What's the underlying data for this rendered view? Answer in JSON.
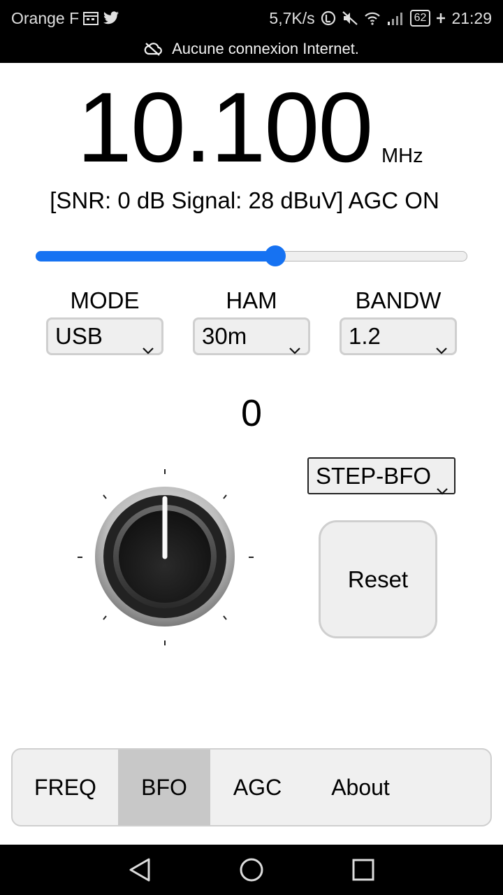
{
  "status_bar": {
    "carrier": "Orange F",
    "net_speed": "5,7K/s",
    "battery": "62",
    "time": "21:29",
    "notice": "Aucune connexion Internet."
  },
  "radio": {
    "frequency": "10.100",
    "unit": "MHz",
    "signal_line": "[SNR:  0 dB Signal:  28 dBuV] AGC ON",
    "slider_fraction": 0.555
  },
  "selects": {
    "mode": {
      "label": "MODE",
      "value": "USB"
    },
    "ham": {
      "label": "HAM",
      "value": "30m"
    },
    "bandw": {
      "label": "BANDW",
      "value": "1.2"
    }
  },
  "bfo": {
    "value": "0",
    "step_select": "STEP-BFO",
    "reset_label": "Reset"
  },
  "tabs": [
    {
      "label": "FREQ",
      "active": false
    },
    {
      "label": "BFO",
      "active": true
    },
    {
      "label": "AGC",
      "active": false
    },
    {
      "label": "About",
      "active": false
    }
  ],
  "colors": {
    "accent": "#1672f2",
    "tab_active": "#c8c8c8",
    "control_bg": "#efefef"
  },
  "icons": [
    "calendar-icon",
    "twitter-icon",
    "data-saver-icon",
    "mute-icon",
    "wifi-icon",
    "signal-icon",
    "cloud-off-icon",
    "back-icon",
    "home-icon",
    "recents-icon"
  ]
}
